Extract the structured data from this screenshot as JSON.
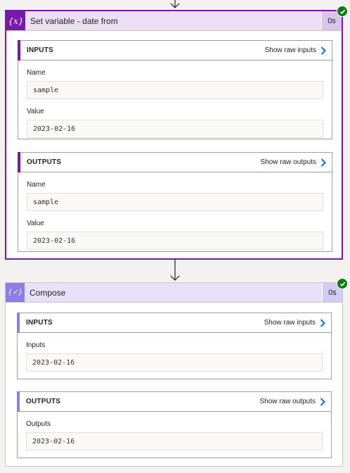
{
  "set_variable": {
    "title": "Set variable - date from",
    "icon": "variable-icon",
    "duration": "0s",
    "status": "succeeded",
    "inputs": {
      "heading": "INPUTS",
      "raw_link": "Show raw inputs",
      "name_label": "Name",
      "name_value": "sample",
      "value_label": "Value",
      "value_value": "2023-02-16"
    },
    "outputs": {
      "heading": "OUTPUTS",
      "raw_link": "Show raw outputs",
      "name_label": "Name",
      "name_value": "sample",
      "value_label": "Value",
      "value_value": "2023-02-16"
    }
  },
  "compose": {
    "title": "Compose",
    "icon": "compose-icon",
    "duration": "0s",
    "status": "succeeded",
    "inputs": {
      "heading": "INPUTS",
      "raw_link": "Show raw inputs",
      "inputs_label": "Inputs",
      "inputs_value": "2023-02-16"
    },
    "outputs": {
      "heading": "OUTPUTS",
      "raw_link": "Show raw outputs",
      "outputs_label": "Outputs",
      "outputs_value": "2023-02-16"
    }
  },
  "colors": {
    "selected_border": "#7719aa",
    "compose_accent": "#8c7ee6",
    "success": "#107c10",
    "link_chevron": "#0078d4"
  }
}
